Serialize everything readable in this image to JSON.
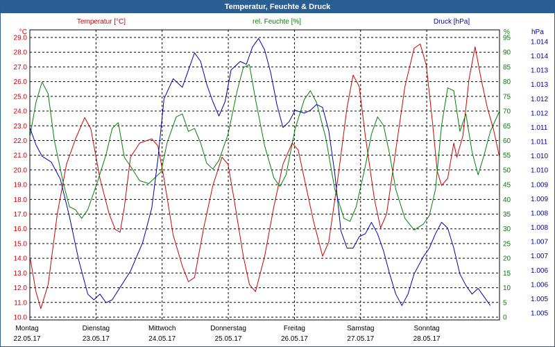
{
  "window": {
    "title": "Temperatur, Feuchte & Druck"
  },
  "colors": {
    "temperature": "#cc0000",
    "humidity": "#008000",
    "pressure": "#0000aa",
    "grid": "#000000",
    "titlebar": "#2b5f93"
  },
  "chart_data": {
    "type": "line",
    "title": "Temperatur, Feuchte & Druck",
    "grid": true,
    "x_range": [
      0,
      7.1
    ],
    "x_ticks": [
      {
        "day": "Montag",
        "date": "22.05.17"
      },
      {
        "day": "Dienstag",
        "date": "23.05.17"
      },
      {
        "day": "Mittwoch",
        "date": "24.05.17"
      },
      {
        "day": "Donnerstag",
        "date": "25.05.17"
      },
      {
        "day": "Freitag",
        "date": "26.05.17"
      },
      {
        "day": "Samstag",
        "date": "27.05.17"
      },
      {
        "day": "Sonntag",
        "date": "28.05.17"
      }
    ],
    "axes": {
      "temperature": {
        "label": "Temperatur [°C]",
        "unit": "°C",
        "ylim": [
          10.0,
          30.5
        ],
        "ticks": [
          "10.0",
          "11.0",
          "12.0",
          "13.0",
          "14.0",
          "15.0",
          "16.0",
          "17.0",
          "18.0",
          "19.0",
          "20.0",
          "21.0",
          "22.0",
          "23.0",
          "24.0",
          "25.0",
          "26.0",
          "27.0",
          "28.0",
          "29.0"
        ]
      },
      "humidity": {
        "label": "rel. Feuchte [%]",
        "unit": "%",
        "ylim": [
          0,
          100
        ],
        "ticks": [
          "0",
          "5",
          "10",
          "15",
          "20",
          "25",
          "30",
          "35",
          "40",
          "45",
          "50",
          "55",
          "60",
          "65",
          "70",
          "75",
          "80",
          "85",
          "90",
          "95"
        ]
      },
      "pressure": {
        "label": "Druck [hPa]",
        "unit": "hPa",
        "ylim": [
          1004.4,
          1014.5
        ],
        "ticks": [
          "1.005",
          "1.005",
          "1.006",
          "1.006",
          "1.007",
          "1.007",
          "1.008",
          "1.008",
          "1.009",
          "1.009",
          "1.010",
          "1.010",
          "1.011",
          "1.011",
          "1.012",
          "1.012",
          "1.013",
          "1.013",
          "1.014",
          "1.014"
        ]
      }
    },
    "series": [
      {
        "name": "Temperatur [°C]",
        "axis": "temperature",
        "points": [
          [
            0,
            14.5
          ],
          [
            0.1,
            12.0
          ],
          [
            0.18,
            10.8
          ],
          [
            0.3,
            12.5
          ],
          [
            0.45,
            17.5
          ],
          [
            0.6,
            21.0
          ],
          [
            0.75,
            22.8
          ],
          [
            0.9,
            24.3
          ],
          [
            1.0,
            23.5
          ],
          [
            1.15,
            20.0
          ],
          [
            1.3,
            17.5
          ],
          [
            1.4,
            16.4
          ],
          [
            1.48,
            16.2
          ],
          [
            1.55,
            18.0
          ],
          [
            1.65,
            21.5
          ],
          [
            1.8,
            22.5
          ],
          [
            2.0,
            22.8
          ],
          [
            2.1,
            22.3
          ],
          [
            2.2,
            20.0
          ],
          [
            2.35,
            16.0
          ],
          [
            2.5,
            13.8
          ],
          [
            2.6,
            12.7
          ],
          [
            2.7,
            13.0
          ],
          [
            2.85,
            16.5
          ],
          [
            3.0,
            19.5
          ],
          [
            3.15,
            21.5
          ],
          [
            3.25,
            21.0
          ],
          [
            3.35,
            18.5
          ],
          [
            3.5,
            14.5
          ],
          [
            3.6,
            12.5
          ],
          [
            3.7,
            12.0
          ],
          [
            3.85,
            14.5
          ],
          [
            4.0,
            18.0
          ],
          [
            4.15,
            21.0
          ],
          [
            4.3,
            22.5
          ],
          [
            4.4,
            22.0
          ],
          [
            4.5,
            20.0
          ],
          [
            4.65,
            17.0
          ],
          [
            4.8,
            14.5
          ],
          [
            4.9,
            15.5
          ],
          [
            5.05,
            20.0
          ],
          [
            5.2,
            25.0
          ],
          [
            5.3,
            27.3
          ],
          [
            5.4,
            26.5
          ],
          [
            5.5,
            23.0
          ],
          [
            5.65,
            18.5
          ],
          [
            5.75,
            16.5
          ],
          [
            5.85,
            17.5
          ],
          [
            6.0,
            22.0
          ],
          [
            6.15,
            26.5
          ],
          [
            6.3,
            29.2
          ],
          [
            6.4,
            29.5
          ],
          [
            6.5,
            28.0
          ],
          [
            6.6,
            24.0
          ],
          [
            6.68,
            20.5
          ],
          [
            6.75,
            19.5
          ],
          [
            6.85,
            20.0
          ],
          [
            6.95,
            22.5
          ],
          [
            7.0,
            21.5
          ],
          [
            7.1,
            23.0
          ],
          [
            7.2,
            27.0
          ],
          [
            7.3,
            29.3
          ],
          [
            7.4,
            27.0
          ],
          [
            7.5,
            25.0
          ],
          [
            7.6,
            23.5
          ],
          [
            7.7,
            21.5
          ]
        ]
      },
      {
        "name": "rel. Feuchte [%]",
        "axis": "humidity",
        "points": [
          [
            0,
            63
          ],
          [
            0.1,
            75
          ],
          [
            0.2,
            82
          ],
          [
            0.3,
            78
          ],
          [
            0.4,
            62
          ],
          [
            0.55,
            47
          ],
          [
            0.65,
            39
          ],
          [
            0.75,
            38
          ],
          [
            0.85,
            35
          ],
          [
            0.95,
            38
          ],
          [
            1.1,
            47
          ],
          [
            1.25,
            57
          ],
          [
            1.35,
            66
          ],
          [
            1.45,
            68
          ],
          [
            1.55,
            56
          ],
          [
            1.65,
            53
          ],
          [
            1.8,
            48
          ],
          [
            1.95,
            47
          ],
          [
            2.05,
            49
          ],
          [
            2.15,
            51
          ],
          [
            2.25,
            61
          ],
          [
            2.4,
            70
          ],
          [
            2.5,
            71
          ],
          [
            2.6,
            65
          ],
          [
            2.7,
            66
          ],
          [
            2.8,
            61
          ],
          [
            2.9,
            54
          ],
          [
            3.0,
            52
          ],
          [
            3.1,
            55
          ],
          [
            3.25,
            64
          ],
          [
            3.4,
            79
          ],
          [
            3.5,
            87
          ],
          [
            3.6,
            88
          ],
          [
            3.7,
            76
          ],
          [
            3.85,
            60
          ],
          [
            4.0,
            49
          ],
          [
            4.1,
            46
          ],
          [
            4.2,
            50
          ],
          [
            4.35,
            66
          ],
          [
            4.5,
            76
          ],
          [
            4.6,
            79
          ],
          [
            4.7,
            75
          ],
          [
            4.85,
            63
          ],
          [
            5.0,
            45
          ],
          [
            5.15,
            35
          ],
          [
            5.25,
            34
          ],
          [
            5.35,
            39
          ],
          [
            5.5,
            53
          ],
          [
            5.6,
            64
          ],
          [
            5.7,
            70
          ],
          [
            5.8,
            67
          ],
          [
            5.9,
            57
          ],
          [
            6.0,
            45
          ],
          [
            6.15,
            35
          ],
          [
            6.3,
            31
          ],
          [
            6.45,
            33
          ],
          [
            6.55,
            36
          ],
          [
            6.65,
            45
          ],
          [
            6.75,
            67
          ],
          [
            6.85,
            80
          ],
          [
            6.95,
            79
          ],
          [
            7.05,
            65
          ],
          [
            7.15,
            71
          ],
          [
            7.25,
            58
          ],
          [
            7.35,
            50
          ],
          [
            7.45,
            57
          ],
          [
            7.55,
            65
          ],
          [
            7.7,
            72
          ]
        ]
      },
      {
        "name": "Druck [hPa]",
        "axis": "pressure",
        "points": [
          [
            0,
            1011.1
          ],
          [
            0.1,
            1010.5
          ],
          [
            0.2,
            1010.1
          ],
          [
            0.35,
            1009.9
          ],
          [
            0.5,
            1009.3
          ],
          [
            0.65,
            1008.0
          ],
          [
            0.8,
            1006.5
          ],
          [
            0.95,
            1005.3
          ],
          [
            1.05,
            1005.1
          ],
          [
            1.15,
            1005.3
          ],
          [
            1.25,
            1005.0
          ],
          [
            1.35,
            1005.1
          ],
          [
            1.5,
            1005.6
          ],
          [
            1.65,
            1006.1
          ],
          [
            1.85,
            1007.1
          ],
          [
            2.0,
            1008.3
          ],
          [
            2.1,
            1010.0
          ],
          [
            2.2,
            1012.1
          ],
          [
            2.35,
            1012.8
          ],
          [
            2.5,
            1012.5
          ],
          [
            2.6,
            1013.1
          ],
          [
            2.7,
            1013.7
          ],
          [
            2.8,
            1013.4
          ],
          [
            2.9,
            1012.6
          ],
          [
            3.0,
            1012.0
          ],
          [
            3.1,
            1011.5
          ],
          [
            3.2,
            1012.0
          ],
          [
            3.3,
            1013.1
          ],
          [
            3.45,
            1013.4
          ],
          [
            3.55,
            1013.3
          ],
          [
            3.65,
            1013.9
          ],
          [
            3.75,
            1014.2
          ],
          [
            3.85,
            1013.8
          ],
          [
            3.95,
            1013.0
          ],
          [
            4.05,
            1011.9
          ],
          [
            4.15,
            1011.1
          ],
          [
            4.25,
            1011.3
          ],
          [
            4.35,
            1011.7
          ],
          [
            4.5,
            1011.6
          ],
          [
            4.6,
            1011.7
          ],
          [
            4.7,
            1011.9
          ],
          [
            4.8,
            1011.8
          ],
          [
            4.9,
            1011.0
          ],
          [
            5.0,
            1009.5
          ],
          [
            5.1,
            1007.5
          ],
          [
            5.2,
            1006.9
          ],
          [
            5.3,
            1006.9
          ],
          [
            5.4,
            1007.3
          ],
          [
            5.5,
            1007.4
          ],
          [
            5.6,
            1007.8
          ],
          [
            5.7,
            1007.4
          ],
          [
            5.8,
            1006.8
          ],
          [
            5.9,
            1006.0
          ],
          [
            6.0,
            1005.3
          ],
          [
            6.1,
            1004.9
          ],
          [
            6.2,
            1005.3
          ],
          [
            6.3,
            1006.0
          ],
          [
            6.45,
            1006.6
          ],
          [
            6.55,
            1006.9
          ],
          [
            6.65,
            1007.4
          ],
          [
            6.75,
            1007.8
          ],
          [
            6.85,
            1007.6
          ],
          [
            6.95,
            1006.9
          ],
          [
            7.05,
            1006.0
          ],
          [
            7.15,
            1005.6
          ],
          [
            7.25,
            1005.3
          ],
          [
            7.35,
            1005.5
          ],
          [
            7.45,
            1005.2
          ],
          [
            7.55,
            1004.9
          ]
        ]
      }
    ]
  }
}
